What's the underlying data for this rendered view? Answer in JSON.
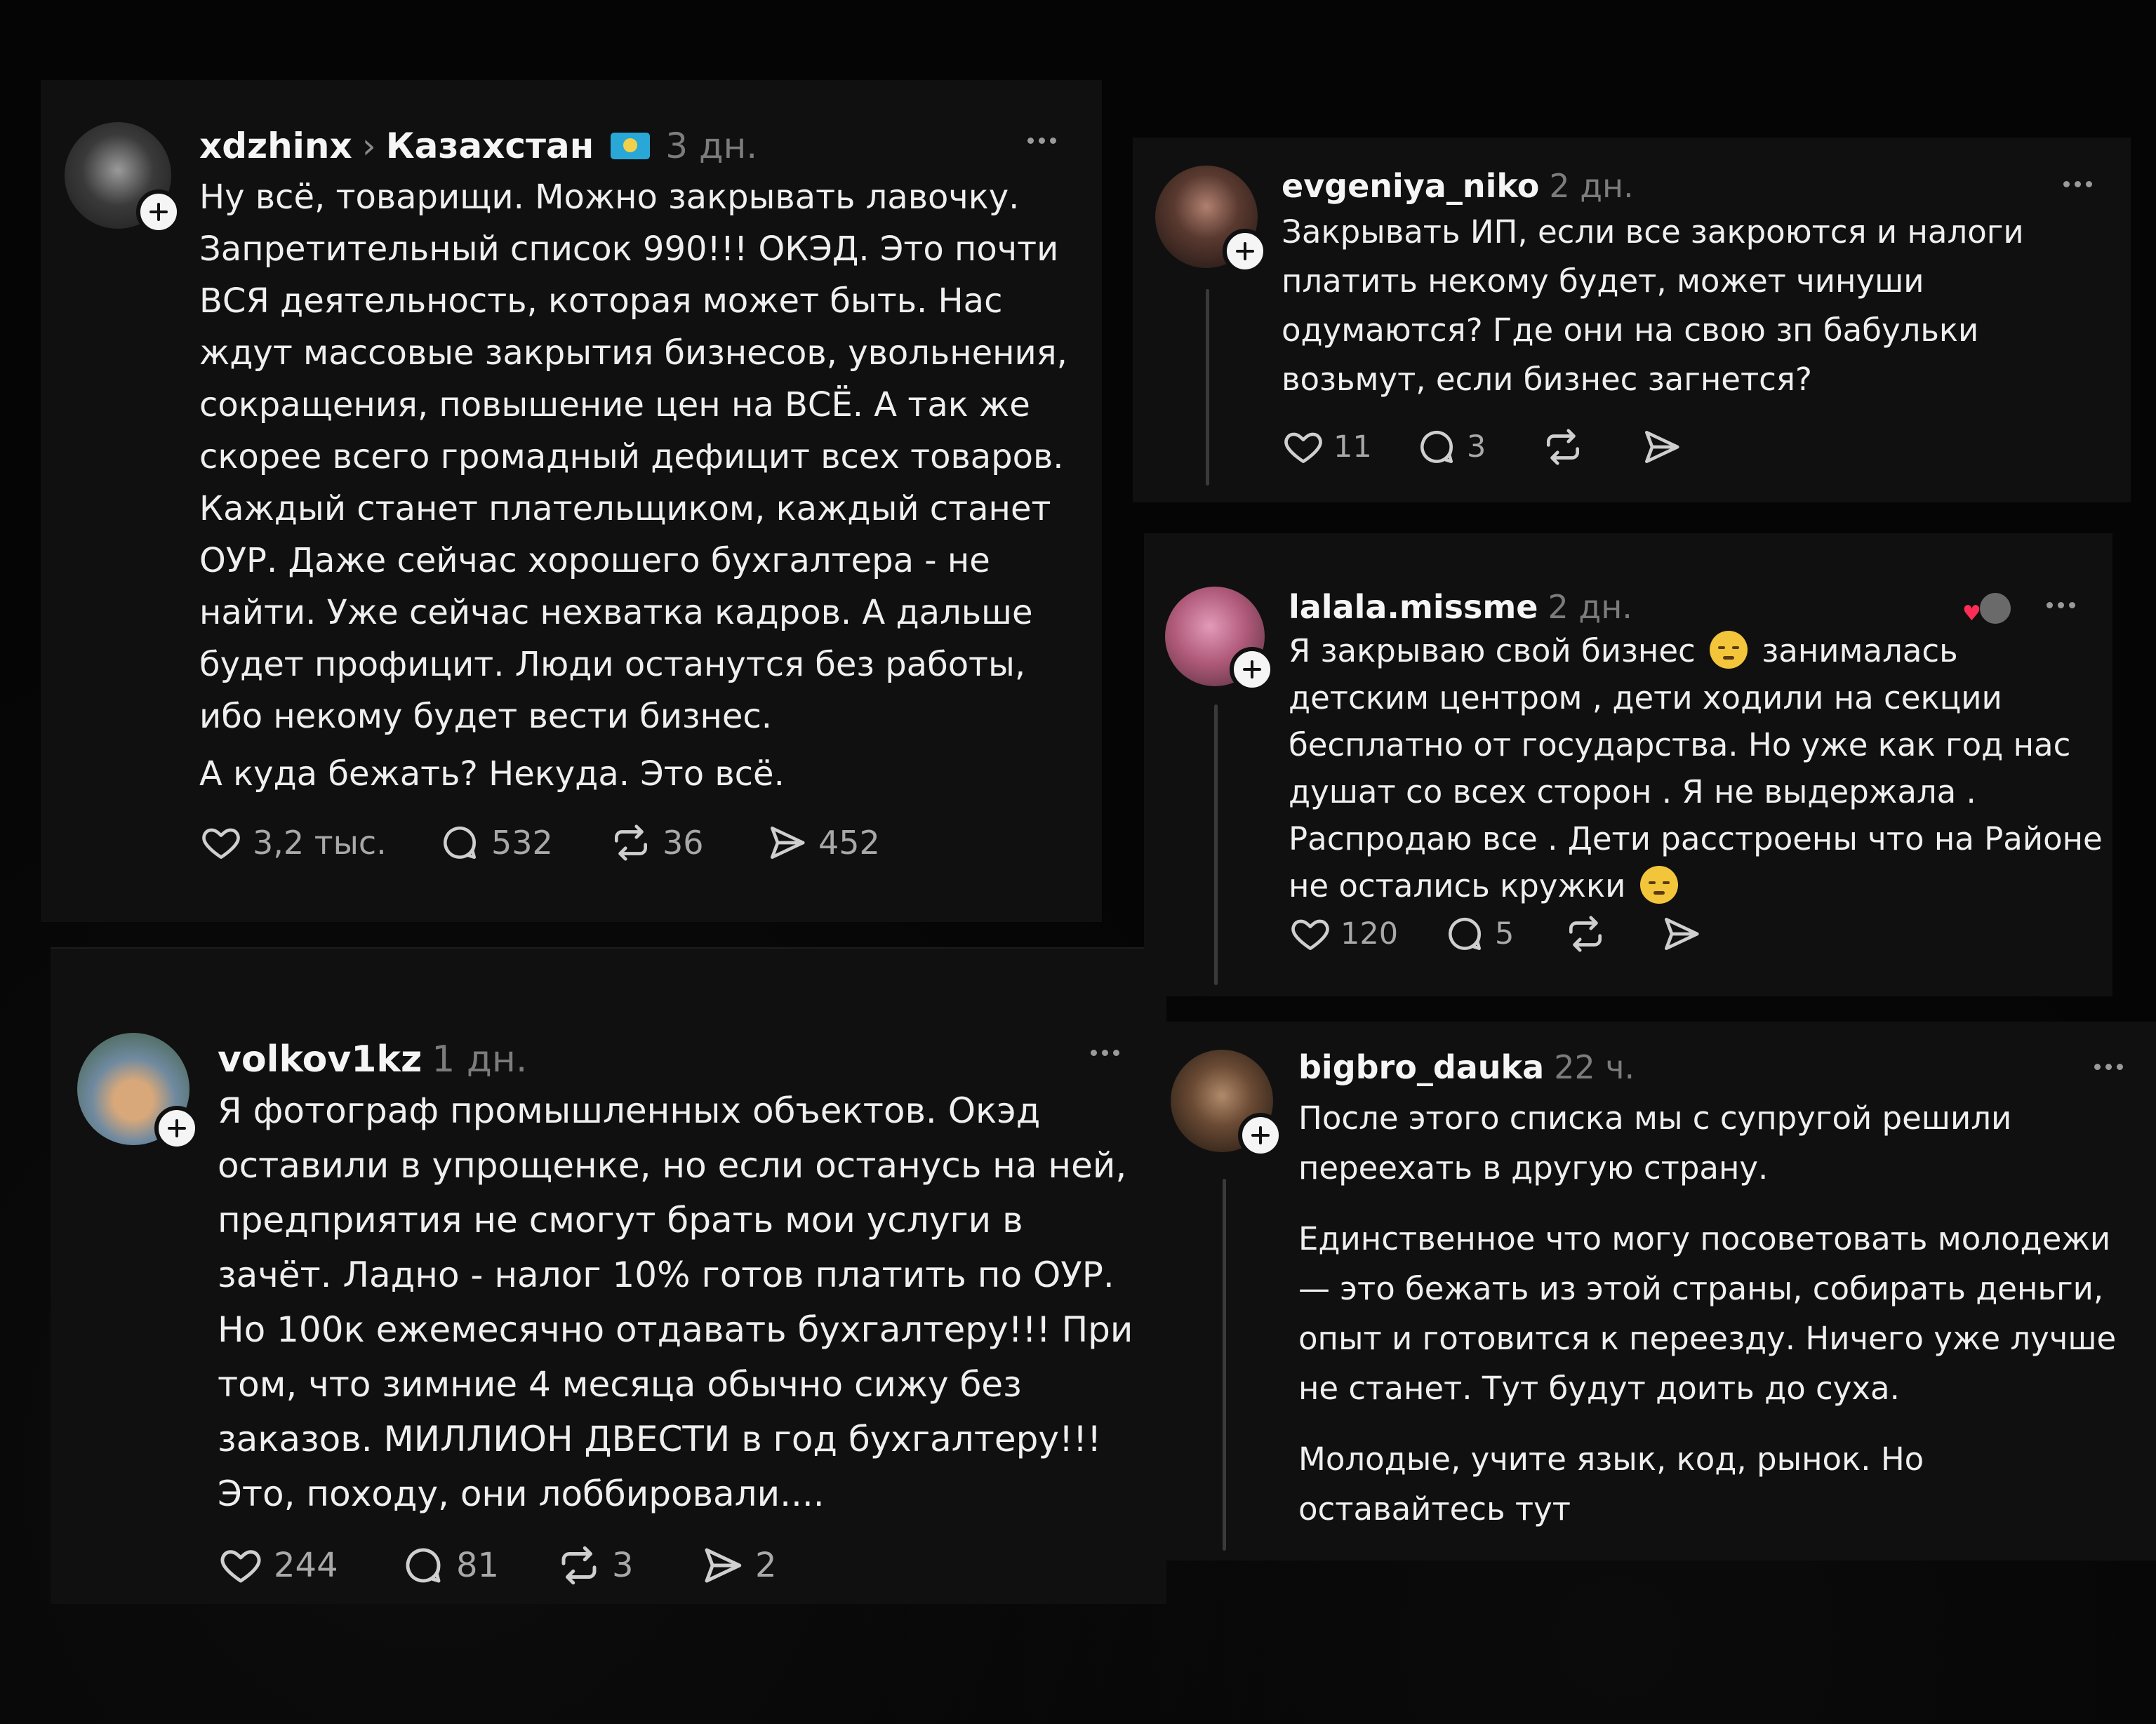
{
  "posts": {
    "p1": {
      "username": "xdzhinx",
      "community": "Казахстан",
      "time": "3 дн.",
      "paragraphs": [
        "Ну всё, товарищи. Можно закрывать лавочку. Запретительный список 990!!! ОКЭД. Это почти ВСЯ деятельность, которая может быть. Нас ждут массовые закрытия бизнесов, увольнения, сокращения, повышение цен на ВСЁ. А так же скорее всего громадный дефицит всех товаров. Каждый станет плательщиком, каждый станет ОУР. Даже сейчас хорошего бухгалтера - не найти. Уже сейчас нехватка кадров. А дальше будет профицит. Люди останутся без работы, ибо некому будет вести бизнес.",
        "А куда бежать? Некуда. Это всё."
      ],
      "likes": "3,2 тыс.",
      "replies": "532",
      "reposts": "36",
      "shares": "452",
      "avatar_color": "#5a5a5a"
    },
    "p2": {
      "username": "volkov1kz",
      "time": "1 дн.",
      "paragraphs": [
        "Я фотограф промышленных объектов. Окэд оставили в упрощенке, но если останусь на ней, предприятия не смогут брать мои услуги в зачёт. Ладно - налог 10% готов платить по ОУР. Но 100к ежемесячно отдавать бухгалтеру!!! При том, что зимние 4 месяца обычно сижу без заказов. МИЛЛИОН ДВЕСТИ в год бухгалтеру!!! Это, походу, они лоббировали...."
      ],
      "likes": "244",
      "replies": "81",
      "reposts": "3",
      "shares": "2",
      "avatar_color": "#6f8aa0"
    },
    "p3": {
      "username": "evgeniya_niko",
      "time": "2 дн.",
      "paragraphs": [
        "Закрывать ИП, если все закроются и налоги платить некому будет, может чинуши одумаются? Где они на свою зп бабульки возьмут, если бизнес загнется?"
      ],
      "likes": "11",
      "replies": "3",
      "avatar_color": "#3a2a24"
    },
    "p4": {
      "username": "lalala.missme",
      "time": "2 дн.",
      "text_before_emoji": "Я закрываю свой бизнес",
      "text_after_emoji": "занималась детским центром , дети ходили на секции бесплатно от государства. Но уже как год нас душат со всех сторон . Я не выдержала . Распродаю все . Дети расстроены что на Районе не остались кружки",
      "likes": "120",
      "replies": "5",
      "avatar_color": "#b05a7a"
    },
    "p5": {
      "username": "bigbro_dauka",
      "time": "22 ч.",
      "paragraphs": [
        "После этого списка мы с супругой решили переехать в другую страну.",
        "Единственное что могу посоветовать молодежи — это бежать из этой страны, собирать деньги, опыт и готовится к переезду. Ничего уже лучше не станет. Тут будут доить до суха.",
        "Молодые, учите язык, код, рынок. Но оставайтесь тут"
      ],
      "avatar_color": "#4a3a2c"
    }
  },
  "colors": {
    "card_bg": "#101010",
    "page_bg": "#050505",
    "muted": "#7c7c7c",
    "text": "#efefef",
    "flag_blue": "#29a8d8",
    "flag_gold": "#f1d04a"
  }
}
